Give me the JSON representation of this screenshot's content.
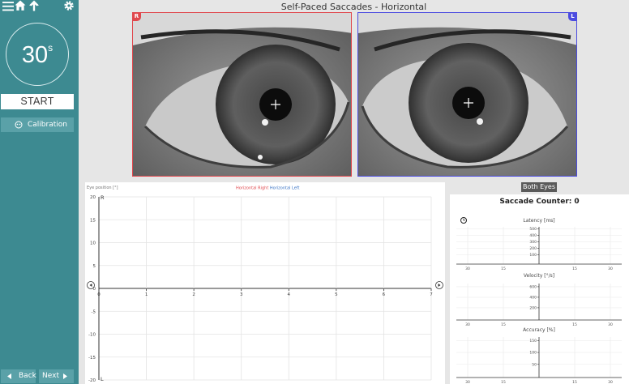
{
  "sidebar": {
    "timer_value": "30",
    "timer_unit": "s",
    "start_label": "START",
    "calibration_label": "Calibration",
    "back_label": "Back",
    "next_label": "Next",
    "icons": [
      "menu-icon",
      "home-icon",
      "arrow-up-icon",
      "gear-icon"
    ]
  },
  "header": {
    "title": "Self-Paced Saccades - Horizontal"
  },
  "eyes": {
    "right_tag": "R",
    "left_tag": "L",
    "right_color": "#e0474c",
    "left_color": "#4c4ce0"
  },
  "buttons": {
    "both_eyes": "Both Eyes"
  },
  "counter": {
    "label": "Saccade Counter:",
    "value": "0"
  },
  "chart_data": [
    {
      "type": "line",
      "ylabel": "Eye position [°]",
      "series": [
        {
          "name": "Horizontal Right",
          "color": "#e0474c",
          "values": []
        },
        {
          "name": "Horizontal Left",
          "color": "#3a74c6",
          "values": []
        }
      ],
      "yticks": [
        "20",
        "15",
        "10",
        "5",
        "0",
        "-5",
        "-10",
        "-15",
        "-20"
      ],
      "xticks": [
        "0",
        "1",
        "2",
        "3",
        "4",
        "5",
        "6",
        "7"
      ],
      "ylim": [
        -20,
        20
      ],
      "xlim": [
        0,
        7
      ],
      "top_marker": "R",
      "bottom_marker": "L"
    },
    {
      "type": "bar",
      "title": "Latency [ms]",
      "yticks": [
        "500",
        "400",
        "300",
        "200",
        "100"
      ],
      "xticks": [
        "30",
        "15",
        "15",
        "30"
      ],
      "values": []
    },
    {
      "type": "bar",
      "title": "Velocity [°/s]",
      "yticks": [
        "600",
        "400",
        "200"
      ],
      "xticks": [
        "30",
        "15",
        "15",
        "30"
      ],
      "values": []
    },
    {
      "type": "bar",
      "title": "Accuracy [%]",
      "yticks": [
        "150",
        "100",
        "50"
      ],
      "xticks": [
        "30",
        "15",
        "15",
        "30"
      ],
      "values": []
    }
  ]
}
